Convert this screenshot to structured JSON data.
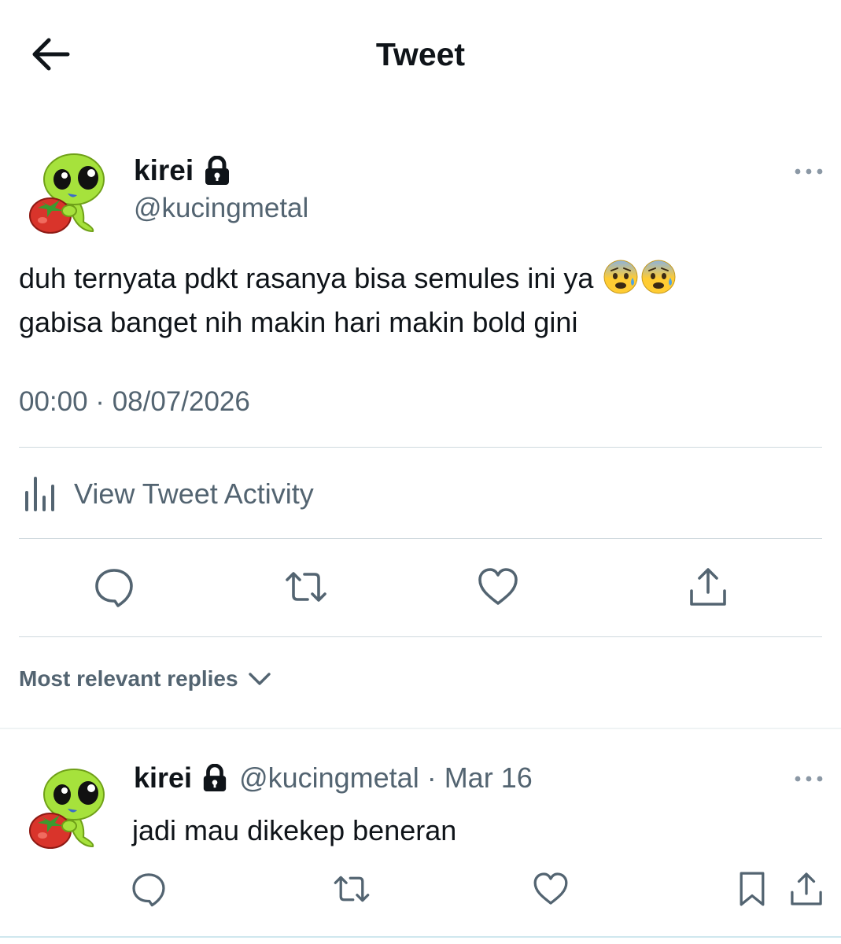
{
  "header": {
    "title": "Tweet"
  },
  "tweet": {
    "author_name": "kirei",
    "author_handle": "@kucingmetal",
    "text_line1": "duh ternyata pdkt rasanya bisa semules ini ya",
    "text_line2": "gabisa banget nih makin hari makin bold gini",
    "timestamp": "00:00 · 08/07/2026",
    "activity_label": "View Tweet Activity"
  },
  "replies_filter": {
    "label": "Most relevant replies"
  },
  "reply": {
    "author_name": "kirei",
    "author_handle": "@kucingmetal",
    "date": "· Mar 16",
    "text": "jadi mau dikekep beneran"
  },
  "icons": {
    "back": "arrow-left-icon",
    "lock": "lock-icon",
    "more": "more-dots-icon",
    "analytics": "bar-chart-icon",
    "reply": "speech-bubble-icon",
    "retweet": "retweet-icon",
    "like": "heart-icon",
    "share": "share-upload-icon",
    "bookmark": "bookmark-icon",
    "chevron": "chevron-down-icon",
    "emoji": "anxious-face-with-sweat-emoji"
  },
  "colors": {
    "text": "#0f1419",
    "secondary": "#536471",
    "divider": "#cfd9de",
    "avatar_green": "#a6e23c",
    "tomato_red": "#d9342b"
  }
}
